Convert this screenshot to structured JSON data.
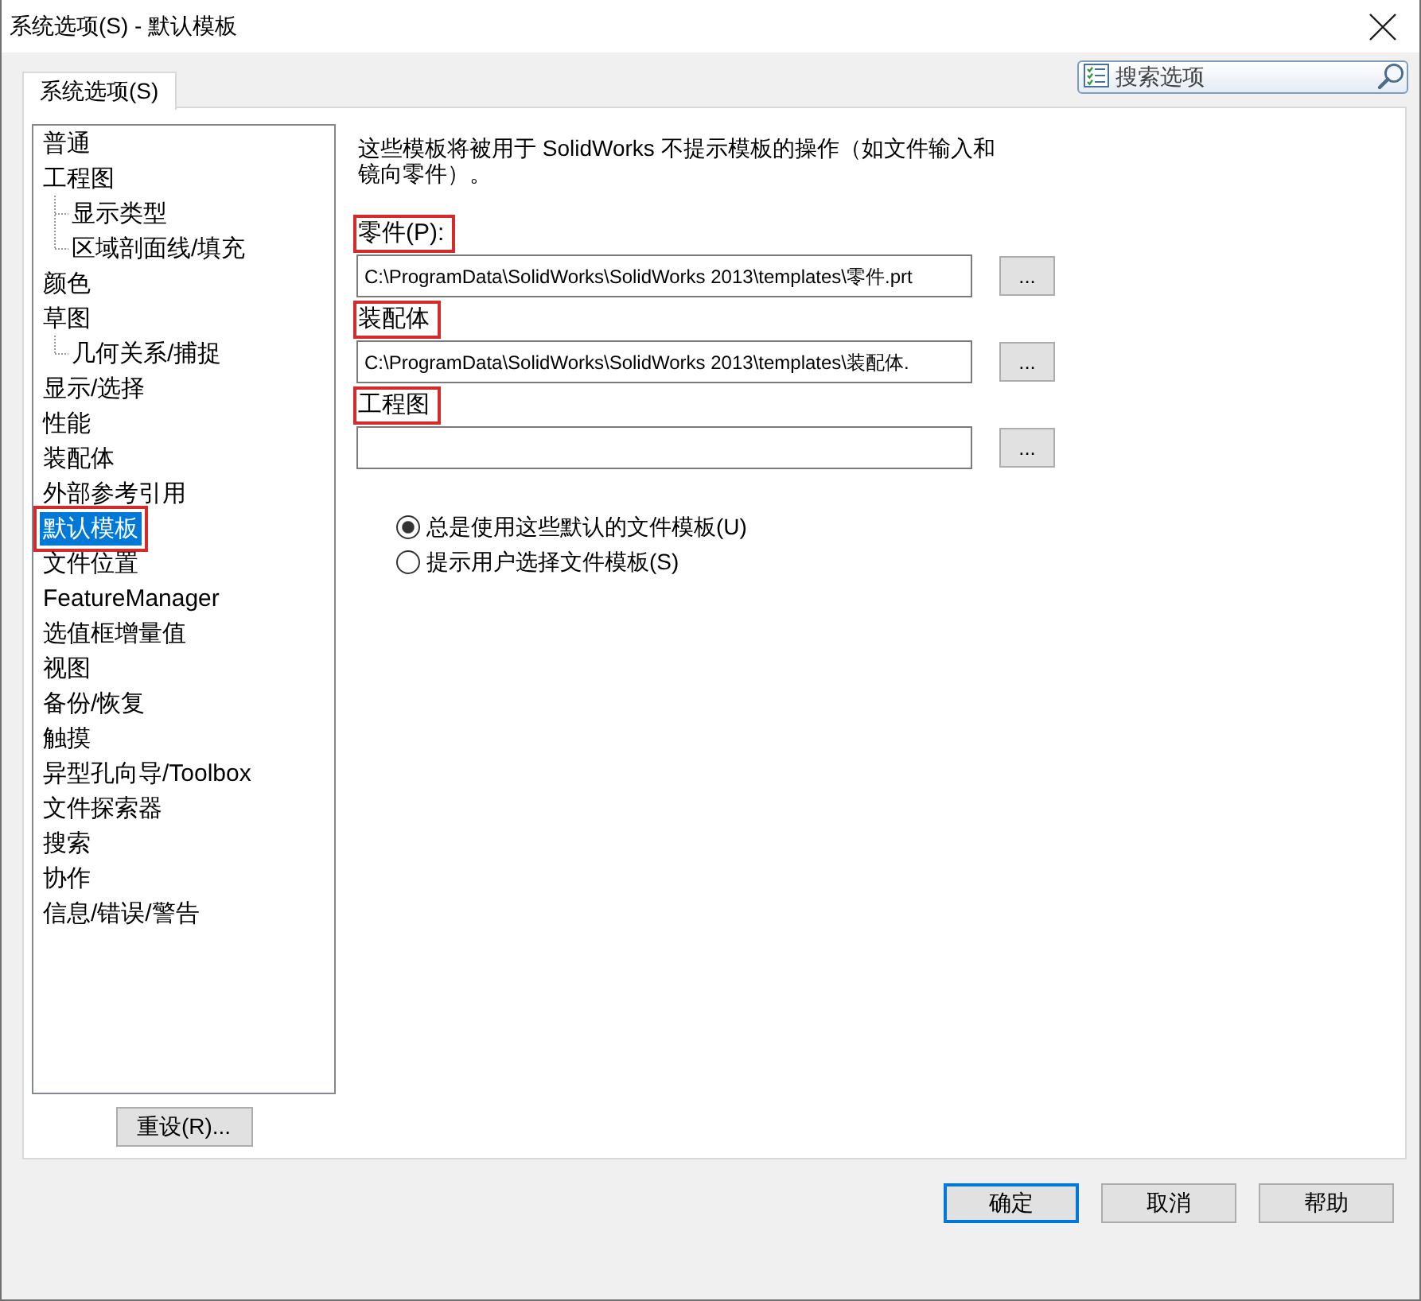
{
  "window": {
    "title": "系统选项(S) - 默认模板"
  },
  "tabs": [
    {
      "label": "系统选项(S)",
      "selected": true
    }
  ],
  "search": {
    "placeholder": "搜索选项"
  },
  "tree": {
    "items": [
      {
        "label": "普通",
        "selected": false,
        "highlighted": false
      },
      {
        "label": "工程图",
        "selected": false,
        "highlighted": false,
        "children": [
          {
            "label": "显示类型",
            "selected": false,
            "highlighted": false
          },
          {
            "label": "区域剖面线/填充",
            "selected": false,
            "highlighted": false
          }
        ]
      },
      {
        "label": "颜色",
        "selected": false,
        "highlighted": false
      },
      {
        "label": "草图",
        "selected": false,
        "highlighted": false,
        "children": [
          {
            "label": "几何关系/捕捉",
            "selected": false,
            "highlighted": false
          }
        ]
      },
      {
        "label": "显示/选择",
        "selected": false,
        "highlighted": false
      },
      {
        "label": "性能",
        "selected": false,
        "highlighted": false
      },
      {
        "label": "装配体",
        "selected": false,
        "highlighted": false
      },
      {
        "label": "外部参考引用",
        "selected": false,
        "highlighted": false
      },
      {
        "label": "默认模板",
        "selected": true,
        "highlighted": true
      },
      {
        "label": "文件位置",
        "selected": false,
        "highlighted": false
      },
      {
        "label": "FeatureManager",
        "selected": false,
        "highlighted": false
      },
      {
        "label": "选值框增量值",
        "selected": false,
        "highlighted": false
      },
      {
        "label": "视图",
        "selected": false,
        "highlighted": false
      },
      {
        "label": "备份/恢复",
        "selected": false,
        "highlighted": false
      },
      {
        "label": "触摸",
        "selected": false,
        "highlighted": false
      },
      {
        "label": "异型孔向导/Toolbox",
        "selected": false,
        "highlighted": false
      },
      {
        "label": "文件探索器",
        "selected": false,
        "highlighted": false
      },
      {
        "label": "搜索",
        "selected": false,
        "highlighted": false
      },
      {
        "label": "协作",
        "selected": false,
        "highlighted": false
      },
      {
        "label": "信息/错误/警告",
        "selected": false,
        "highlighted": false
      }
    ]
  },
  "reset_button": {
    "label": "重设(R)..."
  },
  "description": "这些模板将被用于 SolidWorks 不提示模板的操作（如文件输入和镜向零件）。",
  "templates": [
    {
      "label": "零件(P):",
      "highlighted": true,
      "value": "C:\\ProgramData\\SolidWorks\\SolidWorks 2013\\templates\\零件.prt",
      "browse": "..."
    },
    {
      "label": "装配体",
      "highlighted": true,
      "value": "C:\\ProgramData\\SolidWorks\\SolidWorks 2013\\templates\\装配体.",
      "browse": "..."
    },
    {
      "label": "工程图",
      "highlighted": true,
      "browse": "..."
    }
  ],
  "options": [
    {
      "label": "总是使用这些默认的文件模板(U)",
      "selected": true
    },
    {
      "label": "提示用户选择文件模板(S)",
      "selected": false
    }
  ],
  "buttons": [
    {
      "label": "确定",
      "focused": true
    },
    {
      "label": "取消",
      "focused": false
    },
    {
      "label": "帮助",
      "focused": false
    }
  ]
}
